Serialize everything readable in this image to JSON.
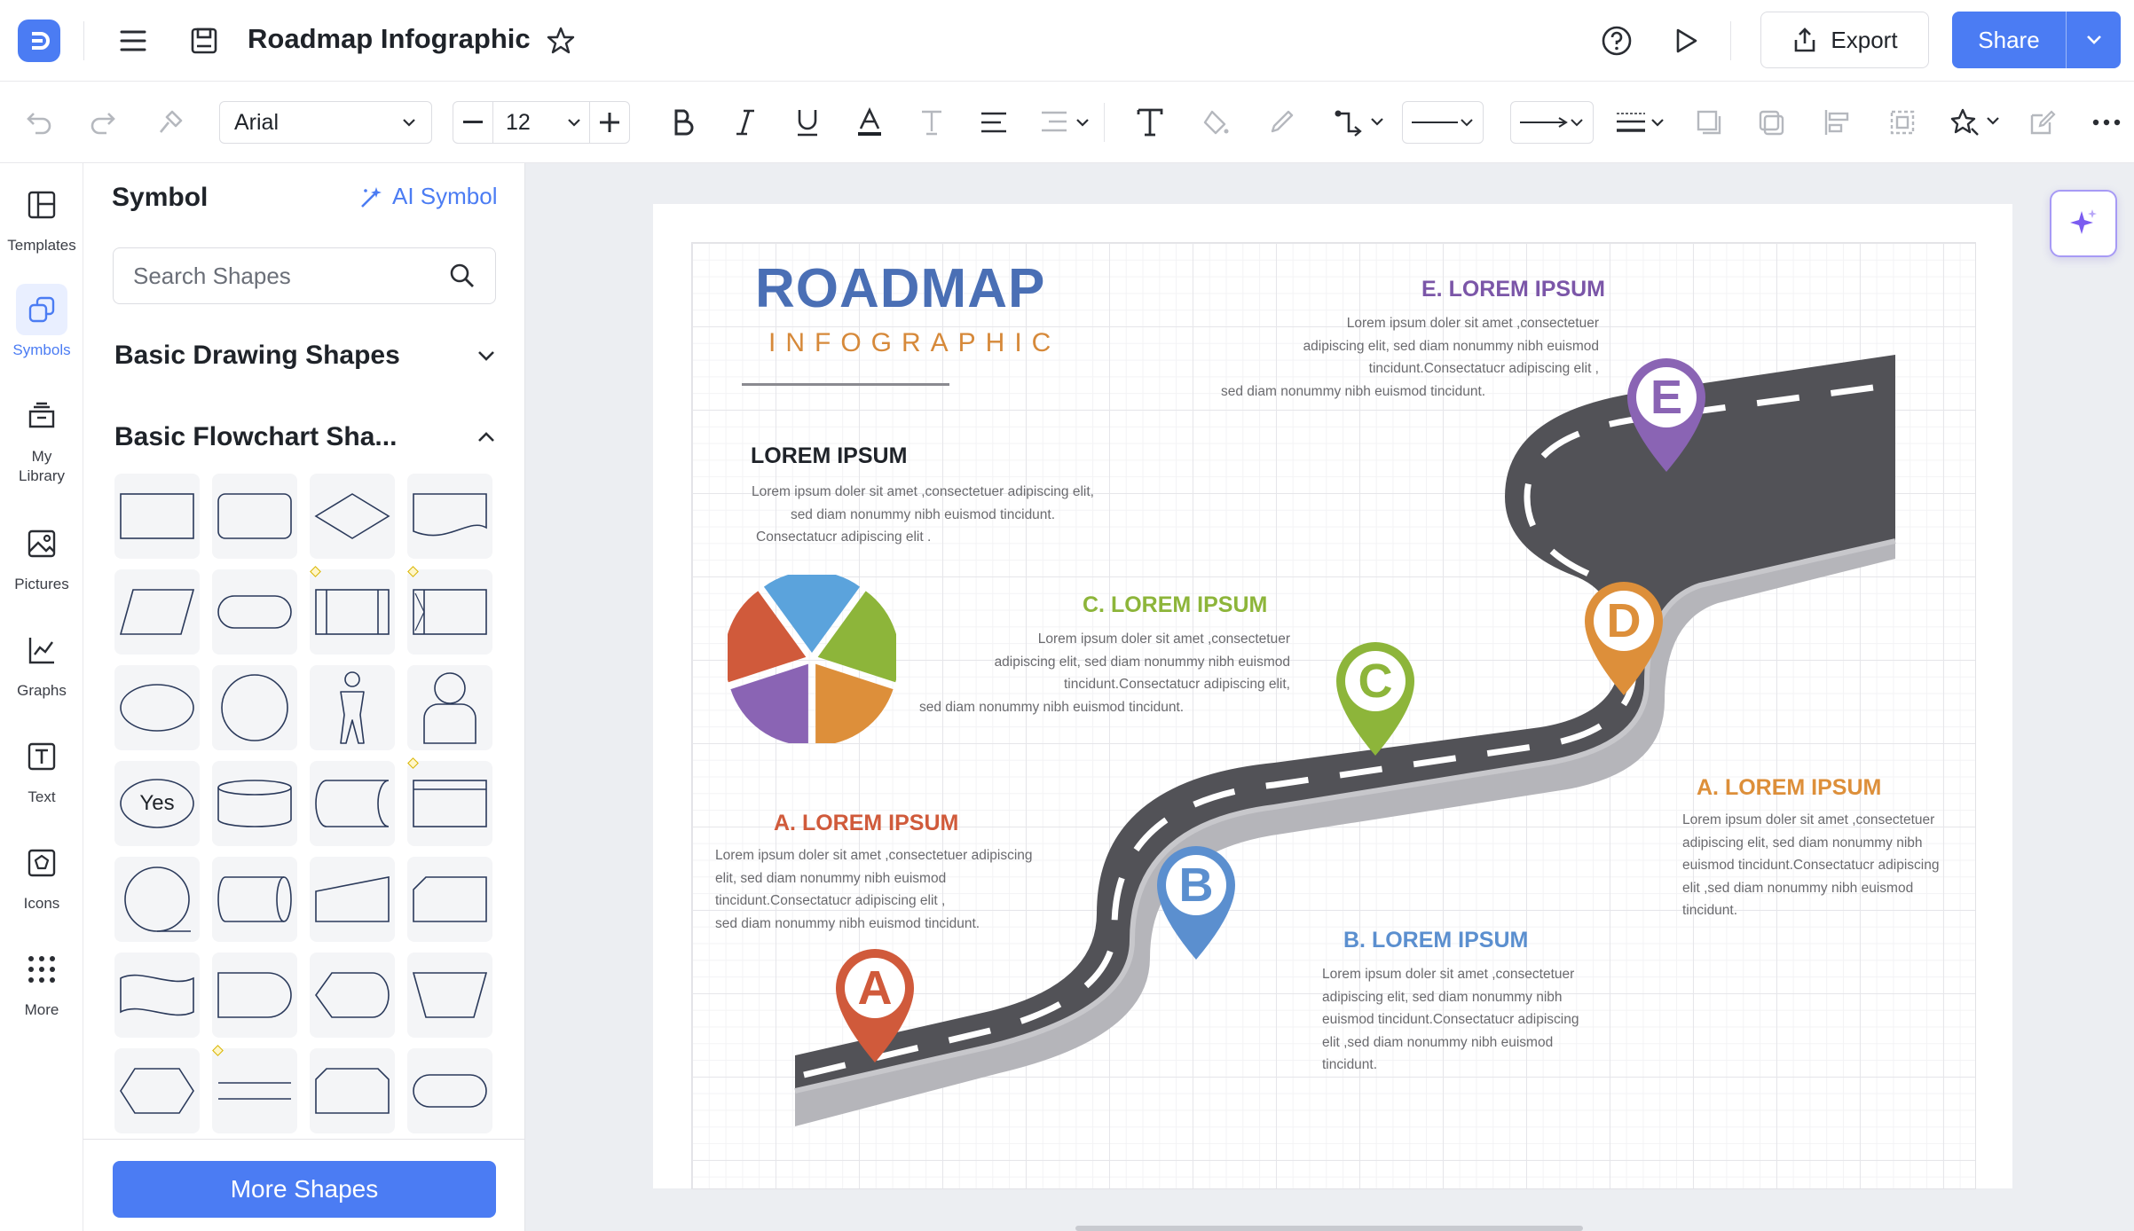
{
  "topbar": {
    "title": "Roadmap Infographic",
    "export_label": "Export",
    "share_label": "Share",
    "icons": [
      "logo-icon",
      "menu-icon",
      "save-icon",
      "star-icon",
      "help-icon",
      "play-icon",
      "export-icon",
      "chevron-down-icon"
    ]
  },
  "toolbar": {
    "font_family": "Arial",
    "font_size": "12",
    "icons": [
      "undo-icon",
      "redo-icon",
      "format-painter-icon",
      "bold-icon",
      "italic-icon",
      "underline-icon",
      "font-color-icon",
      "text-style-icon",
      "align-icon",
      "spacing-icon",
      "text-icon",
      "fill-icon",
      "line-color-icon",
      "connector-icon",
      "line-style-icon",
      "arrow-style-icon",
      "line-weight-icon",
      "front-icon",
      "back-icon",
      "align-objects-icon",
      "group-icon",
      "effects-icon",
      "edit-icon",
      "more-icon"
    ]
  },
  "rail": {
    "items": [
      {
        "label": "Templates",
        "icon": "templates-icon"
      },
      {
        "label": "Symbols",
        "icon": "symbols-icon"
      },
      {
        "label": "My Library",
        "icon": "library-icon"
      },
      {
        "label": "Pictures",
        "icon": "pictures-icon"
      },
      {
        "label": "Graphs",
        "icon": "graphs-icon"
      },
      {
        "label": "Text",
        "icon": "text-box-icon"
      },
      {
        "label": "Icons",
        "icon": "icons-icon"
      },
      {
        "label": "More",
        "icon": "grid-dots-icon"
      }
    ]
  },
  "panel": {
    "title": "Symbol",
    "ai_symbol": "AI Symbol",
    "search_placeholder": "Search Shapes",
    "section1": "Basic Drawing Shapes",
    "section2": "Basic Flowchart Sha...",
    "yes_label": "Yes",
    "more_shapes": "More Shapes"
  },
  "infographic": {
    "title": "ROADMAP",
    "subtitle": "INFOGRAPHIC",
    "lorem_title": "LOREM IPSUM",
    "lorem_body": [
      "Lorem ipsum doler sit amet ,consectetuer adipiscing elit,",
      "sed diam nonummy nibh euismod tincidunt.",
      "Consectatucr adipiscing elit ."
    ],
    "e_title": "E. LOREM IPSUM",
    "e_body": [
      "Lorem ipsum doler sit amet ,consectetuer",
      "adipiscing elit, sed diam nonummy nibh euismod",
      "tincidunt.Consectatucr adipiscing elit ,",
      "sed diam nonummy nibh euismod tincidunt."
    ],
    "c_title": "C. LOREM IPSUM",
    "c_body": [
      "Lorem ipsum doler sit amet ,consectetuer",
      "adipiscing elit, sed diam nonummy nibh euismod",
      "tincidunt.Consectatucr adipiscing elit,",
      "sed diam nonummy nibh euismod tincidunt."
    ],
    "a_left_title": "A. LOREM IPSUM",
    "a_left_body": [
      "Lorem ipsum doler sit amet ,consectetuer adipiscing",
      "elit, sed diam nonummy nibh euismod",
      "tincidunt.Consectatucr adipiscing elit ,",
      "sed diam nonummy nibh euismod tincidunt."
    ],
    "a_right_title": "A. LOREM IPSUM",
    "a_right_body": [
      "Lorem ipsum doler sit amet ,consectetuer",
      "adipiscing elit, sed diam nonummy nibh",
      "euismod tincidunt.Consectatucr adipiscing",
      "elit ,sed diam nonummy nibh euismod",
      "tincidunt."
    ],
    "b_title": "B. LOREM IPSUM",
    "b_body": [
      "Lorem ipsum doler sit amet ,consectetuer",
      "adipiscing elit, sed diam nonummy nibh",
      "euismod tincidunt.Consectatucr adipiscing",
      "elit ,sed diam nonummy nibh euismod",
      "tincidunt."
    ],
    "pins": [
      {
        "letter": "A",
        "color": "#d05a3b"
      },
      {
        "letter": "B",
        "color": "#5b8fcf"
      },
      {
        "letter": "C",
        "color": "#8db53a"
      },
      {
        "letter": "D",
        "color": "#dd8f3a"
      },
      {
        "letter": "E",
        "color": "#8a64b4"
      }
    ],
    "pie_colors": [
      "#5ba3dc",
      "#8db53a",
      "#dd8f3a",
      "#8a64b4",
      "#d05a3b"
    ]
  },
  "colors": {
    "accent": "#4b7cf3",
    "canvas_bg": "#eceef2",
    "road": "#525257",
    "road_edge": "#b8b8bc"
  }
}
